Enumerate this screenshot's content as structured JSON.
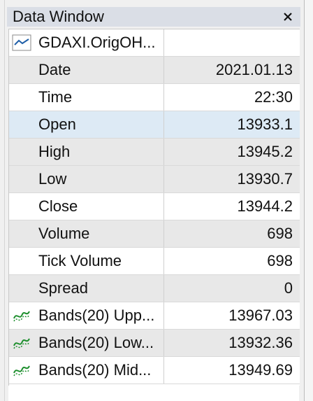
{
  "window": {
    "title": "Data Window",
    "close_icon": "close-icon"
  },
  "header_row": {
    "symbol": "GDAXI.OrigOH...",
    "icon": "line-chart-icon",
    "icon_color": "#1f5fa8"
  },
  "rows": [
    {
      "name": "Date",
      "value": "2021.01.13"
    },
    {
      "name": "Time",
      "value": "22:30"
    },
    {
      "name": "Open",
      "value": "13933.1"
    },
    {
      "name": "High",
      "value": "13945.2"
    },
    {
      "name": "Low",
      "value": "13930.7"
    },
    {
      "name": "Close",
      "value": "13944.2"
    },
    {
      "name": "Volume",
      "value": "698"
    },
    {
      "name": "Tick Volume",
      "value": "698"
    },
    {
      "name": "Spread",
      "value": "0"
    }
  ],
  "indicators": [
    {
      "name": "Bands(20) Upp...",
      "value": "13967.03",
      "icon": "bands-indicator-icon",
      "icon_color": "#1e8f2e"
    },
    {
      "name": "Bands(20) Low...",
      "value": "13932.36",
      "icon": "bands-indicator-icon",
      "icon_color": "#1e8f2e"
    },
    {
      "name": "Bands(20) Mid...",
      "value": "13949.69",
      "icon": "bands-indicator-icon",
      "icon_color": "#1e8f2e"
    }
  ],
  "colors": {
    "titlebar_bg": "#dadee6",
    "row_alt_bg": "#e8e8e8",
    "row_selected_bg": "#ddeaf5"
  }
}
